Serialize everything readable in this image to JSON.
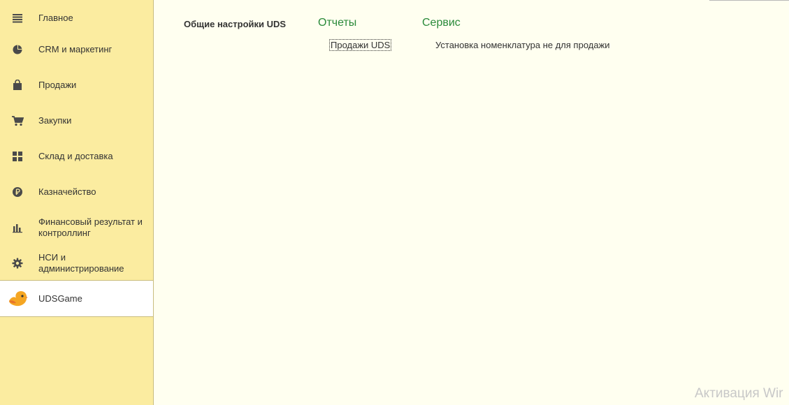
{
  "sidebar": {
    "items": [
      {
        "label": "Главное",
        "icon": "menu-lines-icon"
      },
      {
        "label": "CRM и маркетинг",
        "icon": "pie-chart-icon"
      },
      {
        "label": "Продажи",
        "icon": "shopping-bag-icon"
      },
      {
        "label": "Закупки",
        "icon": "cart-icon"
      },
      {
        "label": "Склад и доставка",
        "icon": "warehouse-grid-icon"
      },
      {
        "label": "Казначейство",
        "icon": "ruble-coin-icon"
      },
      {
        "label": "Финансовый результат и контроллинг",
        "icon": "bar-chart-icon"
      },
      {
        "label": "НСИ и администрирование",
        "icon": "gear-icon"
      },
      {
        "label": "UDSGame",
        "icon": "uds-bird-icon",
        "active": true
      }
    ]
  },
  "main": {
    "sections": {
      "general_title": "Общие настройки UDS",
      "reports_title": "Отчеты",
      "service_title": "Сервис"
    },
    "commands": {
      "sales_uds": "Продажи UDS",
      "set_nomenclature": "Установка номенклатура не для продажи"
    }
  },
  "watermark": "Активация Wir",
  "colors": {
    "sidebar_bg": "#fbeca0",
    "main_bg": "#fffff0",
    "section_link": "#2a8a3a"
  }
}
